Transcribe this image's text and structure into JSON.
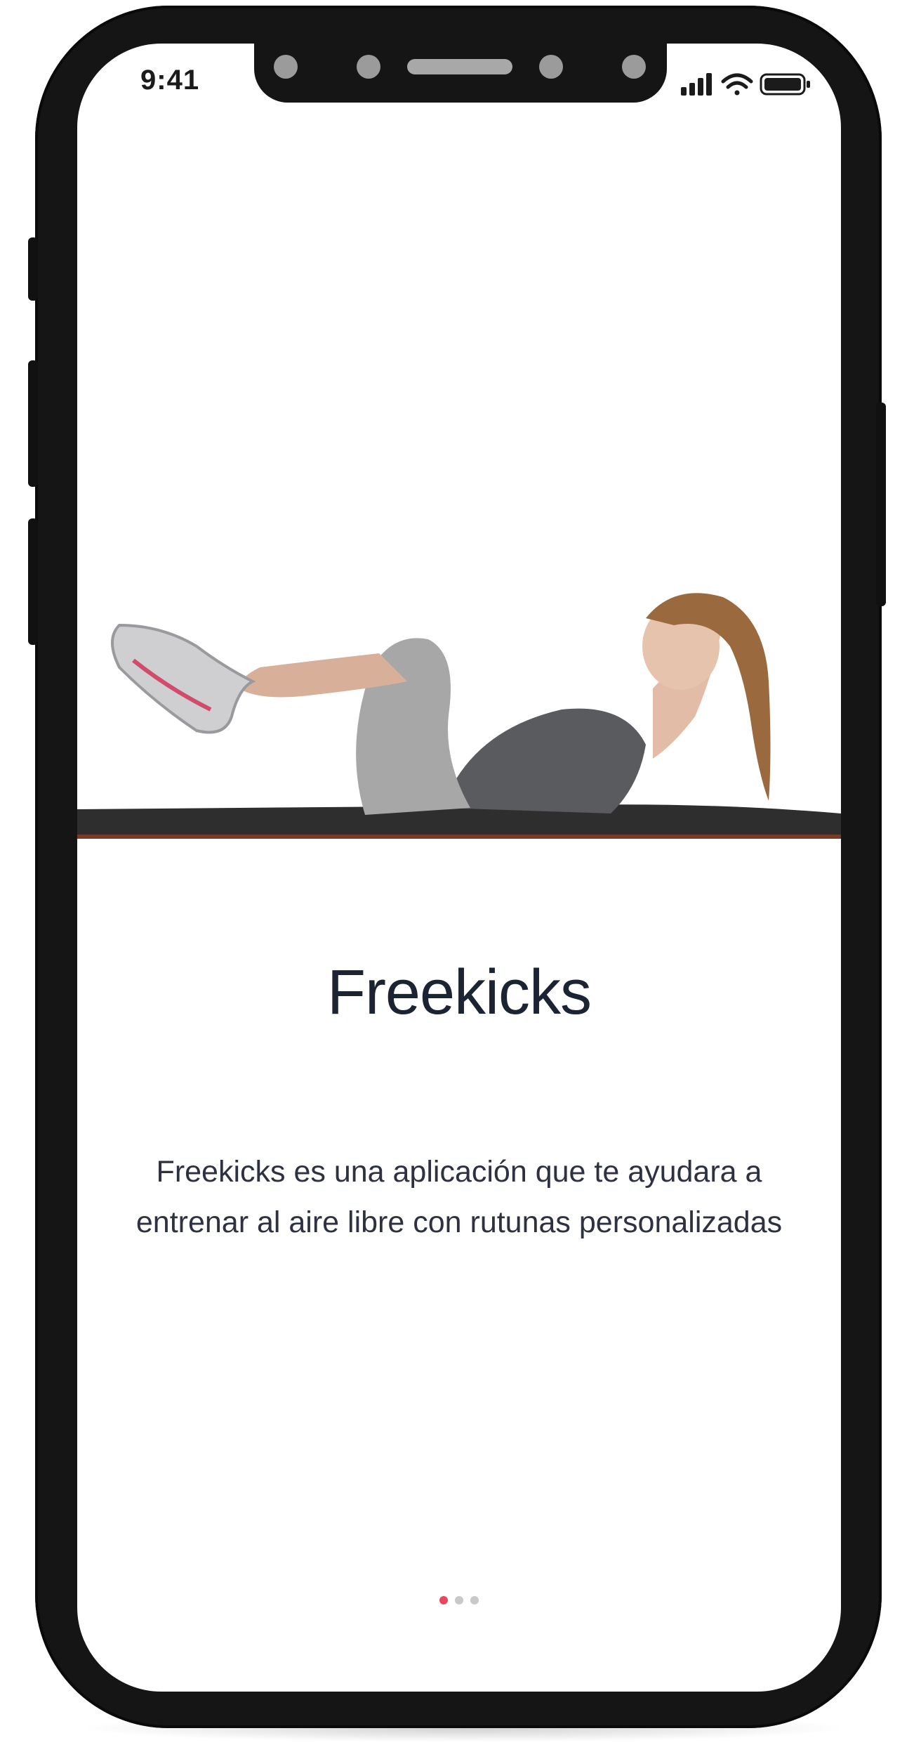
{
  "status_bar": {
    "time": "9:41",
    "icons": [
      "cellular-signal-icon",
      "wifi-icon",
      "battery-icon"
    ]
  },
  "onboarding": {
    "illustration": "woman-doing-crunches-on-mat",
    "title": "Freekicks",
    "description": "Freekicks es una aplicación que te ayudara a entrenar al aire libre con rutunas personalizadas",
    "pager": {
      "total": 3,
      "active_index": 0,
      "active_color": "#e8485f",
      "inactive_color": "#c9c9c9"
    }
  },
  "colors": {
    "frame": "#151515",
    "screen_background": "#ffffff",
    "title_text": "#1c2433",
    "body_text": "#2e3240"
  }
}
